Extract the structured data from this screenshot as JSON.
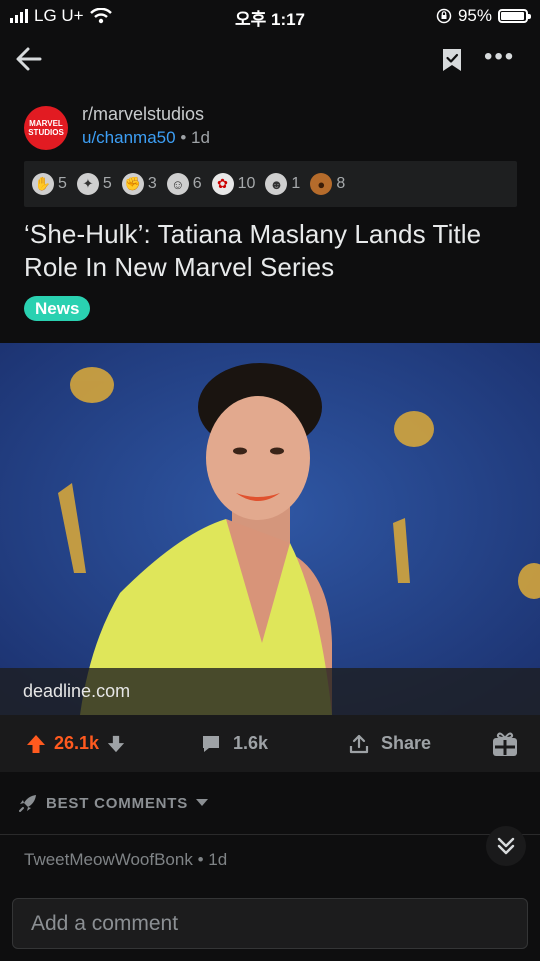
{
  "status_bar": {
    "carrier": "LG U+",
    "time": "오후 1:17",
    "battery_text": "95%",
    "battery_level": 0.95,
    "signal_bars": 4
  },
  "nav": {
    "back_icon": "arrow-left-icon",
    "save_icon": "bookmark-check-icon",
    "more_label": "•••"
  },
  "post": {
    "subreddit": "r/marvelstudios",
    "author": "u/chanma50",
    "age": "• 1d",
    "subreddit_avatar_text": "MARVEL STUDIOS",
    "awards": [
      {
        "icon": "award-1",
        "count": "5"
      },
      {
        "icon": "award-2",
        "count": "5"
      },
      {
        "icon": "award-3",
        "count": "3"
      },
      {
        "icon": "award-4",
        "count": "6"
      },
      {
        "icon": "award-5",
        "count": "10"
      },
      {
        "icon": "award-6",
        "count": "1"
      },
      {
        "icon": "award-7",
        "count": "8"
      }
    ],
    "title": "‘She-Hulk’: Tatiana Maslany Lands Title Role In New Marvel Series",
    "flair": "News",
    "link_domain": "deadline.com",
    "score": "26.1k",
    "comments_count": "1.6k",
    "share_label": "Share"
  },
  "comments": {
    "sort_label": "BEST COMMENTS",
    "first_author": "TweetMeowWoofBonk",
    "first_age": "• 1d",
    "input_placeholder": "Add a comment"
  },
  "colors": {
    "background": "#0e0e0f",
    "upvote": "#ff5a1f",
    "link_blue": "#3d9ff5",
    "flair": "#2ad1b1"
  }
}
